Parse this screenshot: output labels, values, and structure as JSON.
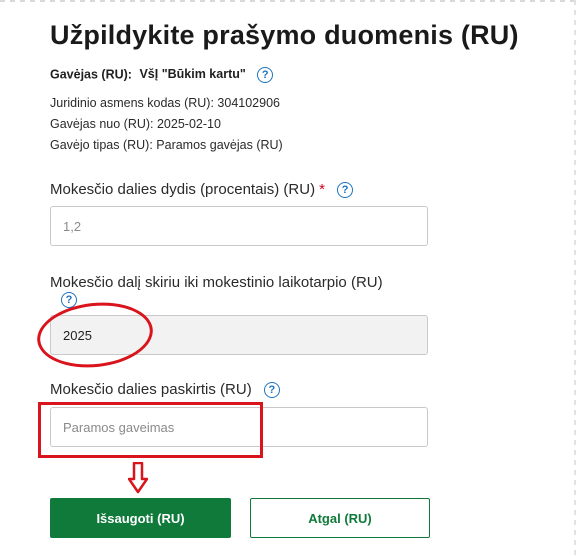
{
  "title": "Užpildykite prašymo duomenis (RU)",
  "recipient": {
    "label": "Gavėjas (RU):",
    "name": "VšĮ \"Būkim kartu\""
  },
  "info": {
    "company_code": "Juridinio asmens kodas (RU): 304102906",
    "recipient_since": "Gavėjas nuo (RU): 2025-02-10",
    "recipient_type": "Gavėjo tipas (RU): Paramos gavėjas (RU)"
  },
  "fields": {
    "percent": {
      "label": "Mokesčio dalies dydis (procentais) (RU)",
      "required_mark": "*",
      "value": "1,2"
    },
    "period": {
      "label": "Mokesčio dalį skiriu iki mokestinio laikotarpio (RU)",
      "value": "2025"
    },
    "purpose": {
      "label": "Mokesčio dalies paskirtis (RU)",
      "placeholder": "Paramos gaveimas"
    }
  },
  "help_glyph": "?",
  "buttons": {
    "save": "Išsaugoti (RU)",
    "back": "Atgal (RU)"
  },
  "colors": {
    "primary": "#0f7a3a",
    "annotation": "#d9141c",
    "help": "#1e73be"
  },
  "icons": [
    "help-icon",
    "down-arrow-icon"
  ]
}
